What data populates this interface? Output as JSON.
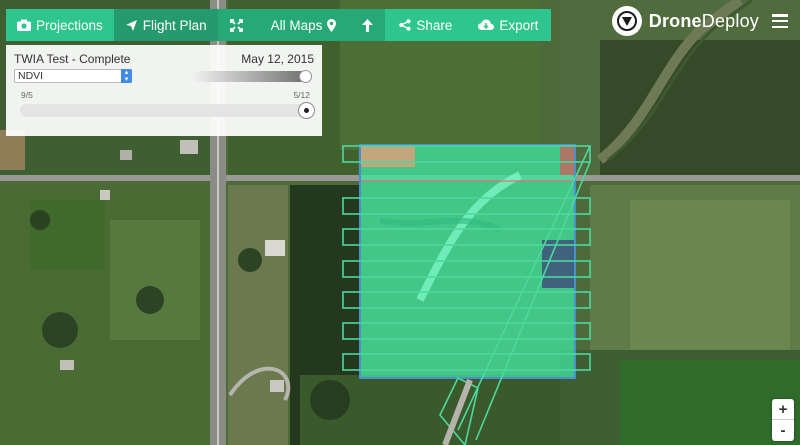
{
  "toolbar": {
    "projections": "Projections",
    "flight_plan": "Flight Plan",
    "all_maps": "All Maps",
    "share": "Share",
    "export": "Export"
  },
  "brand": {
    "name_bold": "Drone",
    "name_rest": "Deploy"
  },
  "panel": {
    "map_name": "TWIA Test - Complete",
    "date": "May 12, 2015",
    "layer_selected": "NDVI",
    "range_start": "9/5",
    "range_end": "5/12",
    "opacity": 1.0
  },
  "zoom": {
    "in": "+",
    "out": "-"
  },
  "icons": [
    "camera-icon",
    "plane-icon",
    "expand-icon",
    "map-pin-icon",
    "arrow-up-icon",
    "share-icon",
    "cloud-download-icon",
    "dronedeploy-logo-icon",
    "hamburger-menu-icon"
  ],
  "colors": {
    "toolbar_green": "#2fc58e",
    "toolbar_active": "#259a6f",
    "ndvi_overlay": "#3fe5a0",
    "flight_path": "#4cd8a0",
    "boundary_blue": "#4a8fd0"
  }
}
